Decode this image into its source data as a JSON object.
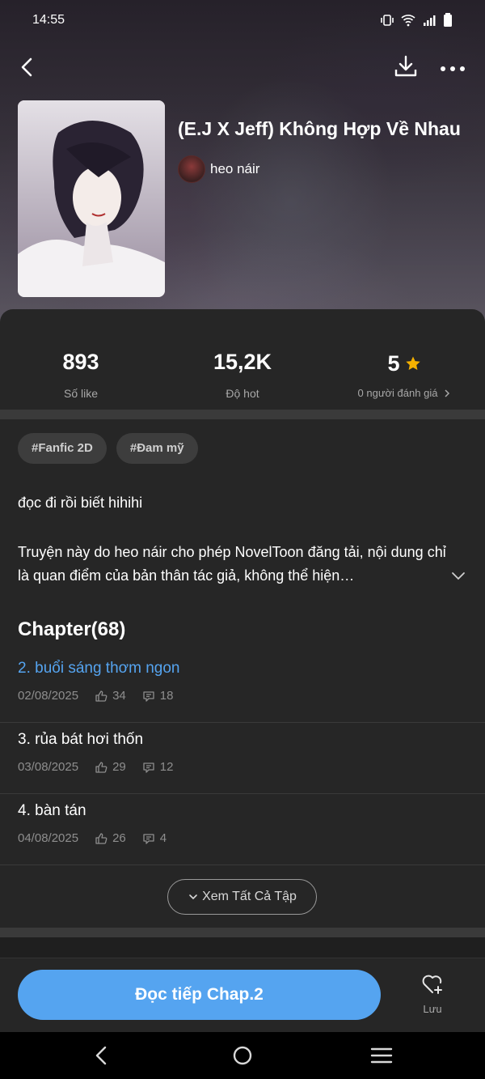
{
  "status_bar": {
    "time": "14:55"
  },
  "story": {
    "title": "(E.J X Jeff) Không Hợp Về Nhau",
    "author": "heo náir"
  },
  "stats": [
    {
      "value": "893",
      "label": "Số like"
    },
    {
      "value": "15,2K",
      "label": "Độ hot"
    },
    {
      "value": "5",
      "label": "0 người đánh giá"
    }
  ],
  "tags": [
    "#Fanfic 2D",
    "#Đam mỹ"
  ],
  "description": {
    "short": "đọc đi rồi biết hihihi",
    "long": "Truyện này do heo náir cho phép NovelToon đăng tải, nội dung chỉ là quan điểm của bản thân tác giả, không thể hiện…"
  },
  "chapters": {
    "heading": "Chapter(68)",
    "items": [
      {
        "title": "2. buổi sáng thơm ngon",
        "date": "02/08/2025",
        "likes": "34",
        "comments": "18"
      },
      {
        "title": "3. rủa bát hơi thốn",
        "date": "03/08/2025",
        "likes": "29",
        "comments": "12"
      },
      {
        "title": "4. bàn tán",
        "date": "04/08/2025",
        "likes": "26",
        "comments": "4"
      }
    ],
    "see_all_label": "Xem Tất Cả Tập"
  },
  "actions": {
    "read_label": "Đọc tiếp Chap.2",
    "save_label": "Lưu"
  },
  "colors": {
    "accent": "#55a4f0",
    "star": "#f5b100",
    "background": "#262626"
  }
}
